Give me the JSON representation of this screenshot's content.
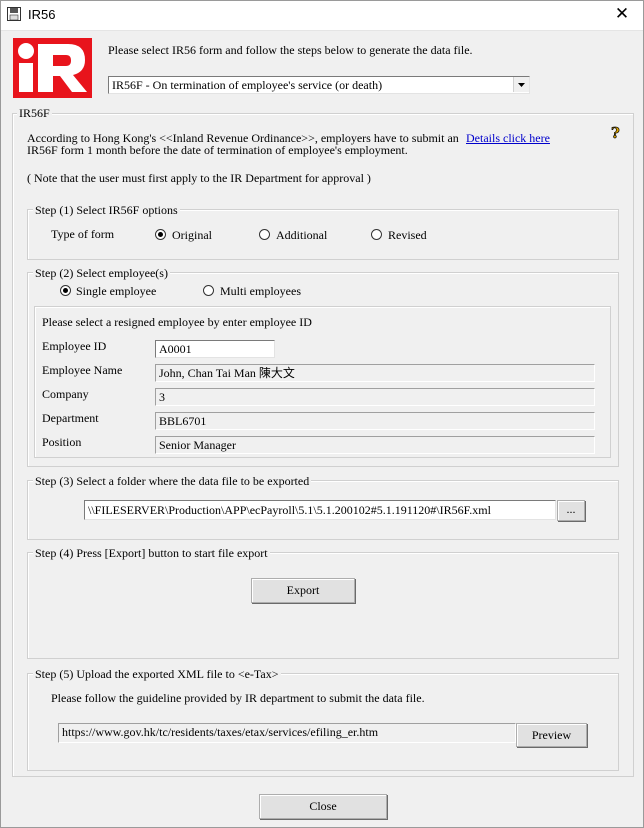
{
  "window": {
    "title": "IR56",
    "close_glyph": "✕"
  },
  "header": {
    "logo_text": "IR",
    "instruction": "Please select IR56 form and follow the steps below to generate the data file.",
    "form_select_value": "IR56F - On termination of employee's service (or death)"
  },
  "ir56f": {
    "group_label": "IR56F",
    "intro_line1": "According to Hong Kong's <<Inland Revenue Ordinance>>, employers have to submit an",
    "intro_line2": "IR56F form 1 month before the date of termination of employee's employment.",
    "details_link": "Details click here",
    "help_glyph": "?",
    "note": "( Note that the user must first apply to the IR Department for approval )"
  },
  "step1": {
    "label": "Step (1) Select IR56F options",
    "type_label": "Type of form",
    "options": [
      "Original",
      "Additional",
      "Revised"
    ],
    "selected": "Original"
  },
  "step2": {
    "label": "Step (2) Select employee(s)",
    "options": [
      "Single employee",
      "Multi employees"
    ],
    "selected": "Single employee",
    "inner_title": "Please select a resigned employee by enter employee ID",
    "fields": {
      "employee_id_label": "Employee ID",
      "employee_id_value": "A0001",
      "employee_name_label": "Employee Name",
      "employee_name_value": "John, Chan Tai Man 陳大文",
      "company_label": "Company",
      "company_value": "3",
      "department_label": "Department",
      "department_value": "BBL6701",
      "position_label": "Position",
      "position_value": "Senior Manager"
    }
  },
  "step3": {
    "label": "Step (3) Select a folder where the data file to be exported",
    "path_value": "\\\\FILESERVER\\Production\\APP\\ecPayroll\\5.1\\5.1.200102#5.1.191120#\\IR56F.xml",
    "browse_label": "..."
  },
  "step4": {
    "label": "Step (4) Press [Export] button to start file export",
    "export_label": "Export"
  },
  "step5": {
    "label": "Step (5) Upload the exported XML file to <e-Tax>",
    "guideline": "Please follow the guideline provided by IR department to submit the data file.",
    "url_value": "https://www.gov.hk/tc/residents/taxes/etax/services/efiling_er.htm",
    "preview_label": "Preview"
  },
  "footer": {
    "close_label": "Close"
  },
  "colors": {
    "logo_red": "#e8141c",
    "link_blue": "#0000cc",
    "dialog_bg": "#f0f0f0"
  }
}
